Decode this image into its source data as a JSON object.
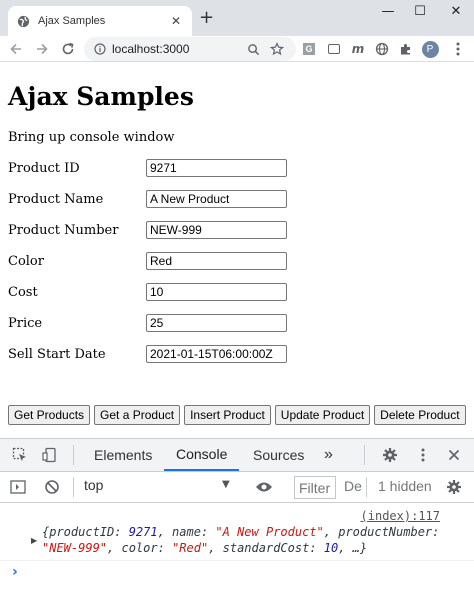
{
  "browser": {
    "tab_title": "Ajax Samples",
    "tab_close": "✕",
    "new_tab": "+",
    "window": {
      "minimize": "—",
      "maximize": "☐",
      "close": "✕"
    },
    "url": "localhost:3000",
    "profile_initial": "P",
    "extensions": [
      "G",
      "m",
      "Ð"
    ]
  },
  "page": {
    "title": "Ajax Samples",
    "note": "Bring up console window",
    "fields": [
      {
        "label": "Product ID",
        "value": "9271"
      },
      {
        "label": "Product Name",
        "value": "A New Product"
      },
      {
        "label": "Product Number",
        "value": "NEW-999"
      },
      {
        "label": "Color",
        "value": "Red"
      },
      {
        "label": "Cost",
        "value": "10"
      },
      {
        "label": "Price",
        "value": "25"
      },
      {
        "label": "Sell Start Date",
        "value": "2021-01-15T06:00:00Z"
      }
    ],
    "buttons": [
      "Get Products",
      "Get a Product",
      "Insert Product",
      "Update Product",
      "Delete Product"
    ]
  },
  "devtools": {
    "tabs": [
      "Elements",
      "Console",
      "Sources"
    ],
    "more_tabs": "»",
    "context": "top",
    "filter_placeholder": "Filter",
    "levels": "De",
    "hidden": "1 hidden",
    "source_link": "(index):117",
    "log": {
      "open": "{productID: ",
      "id": "9271",
      "k_name": ", name: ",
      "name": "\"A New Product\"",
      "k_num": ", productNumber: ",
      "num": "\"NEW-999\"",
      "k_color": ", color: ",
      "color": "\"Red\"",
      "k_cost": ", standardCost: ",
      "cost": "10",
      "close": ", …}"
    },
    "prompt": "›"
  },
  "colors": {
    "accent": "#1a73e8",
    "string": "#c41a16",
    "number": "#1a1aa6"
  }
}
